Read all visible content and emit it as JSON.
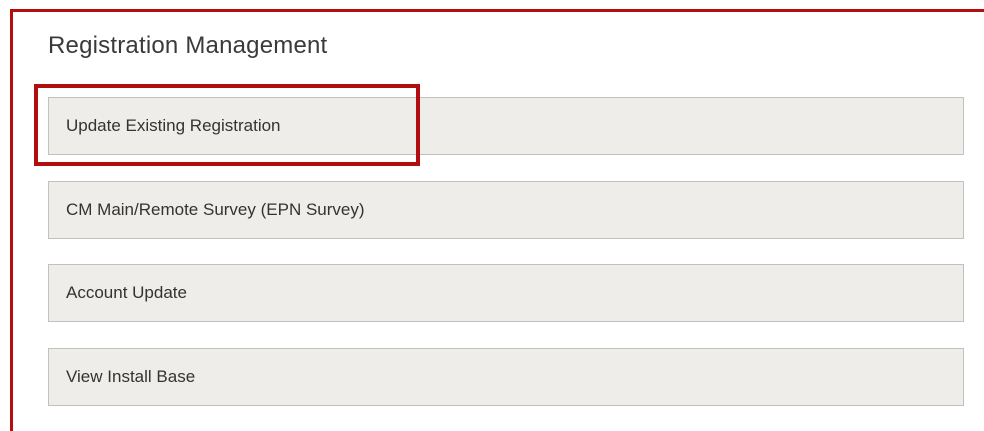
{
  "section": {
    "title": "Registration Management"
  },
  "options": [
    {
      "label": "Update Existing Registration"
    },
    {
      "label": "CM Main/Remote Survey (EPN Survey)"
    },
    {
      "label": "Account Update"
    },
    {
      "label": "View Install Base"
    }
  ],
  "colors": {
    "frame_border": "#b20e10",
    "highlight_border": "#b20e10",
    "option_background": "#efedea",
    "option_border": "#c4c1bd",
    "text": "#333333"
  }
}
